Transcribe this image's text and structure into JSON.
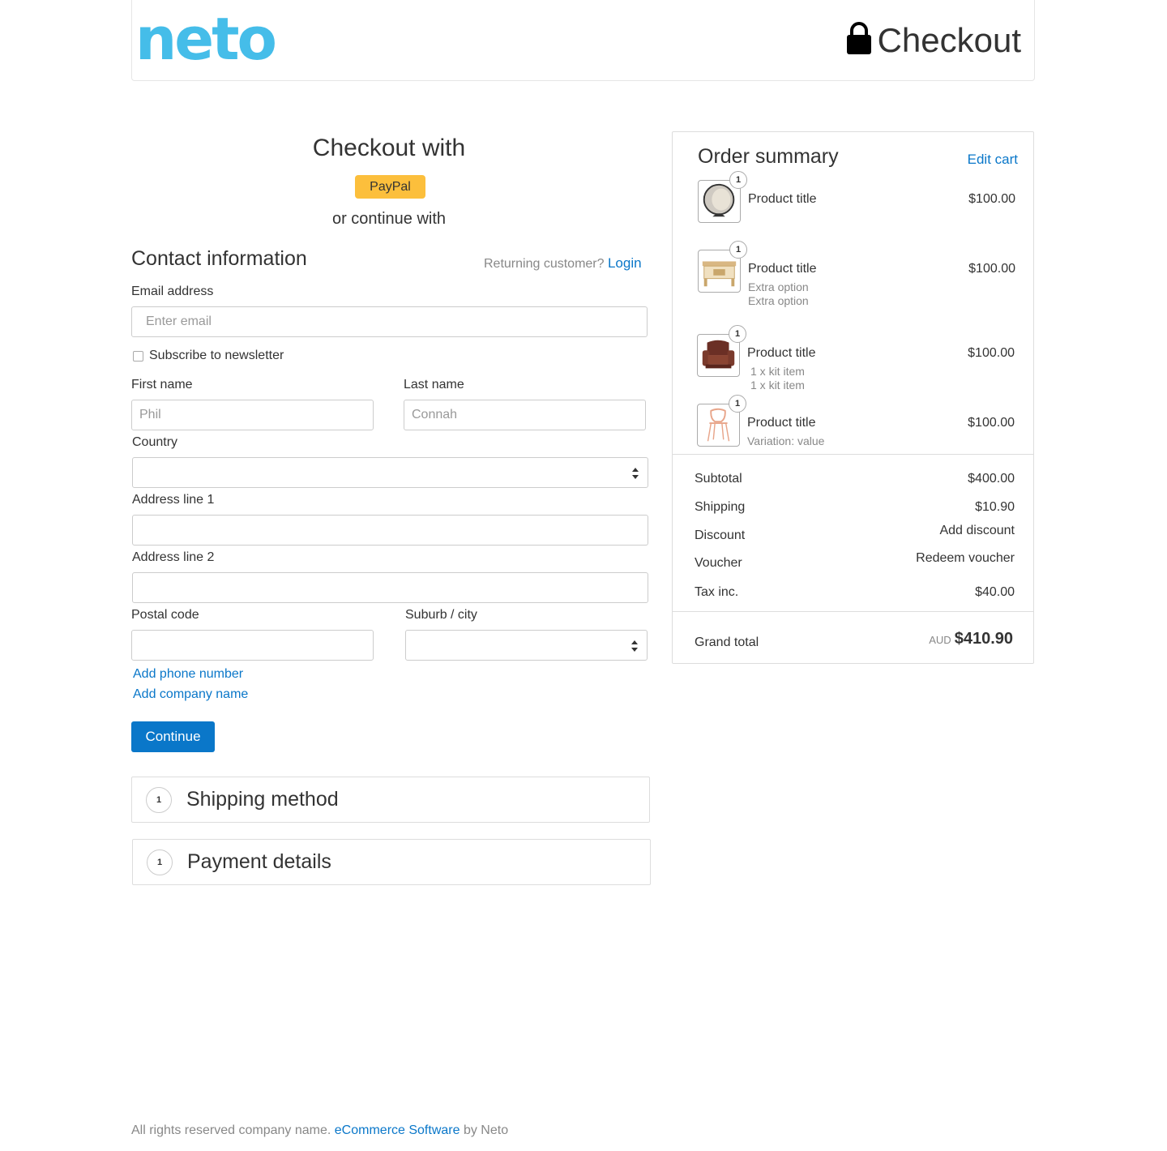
{
  "header": {
    "logo_text": "neto",
    "logo_color": "#45bde9",
    "title": "Checkout",
    "lock_icon": "lock-icon"
  },
  "express": {
    "title": "Checkout with",
    "paypal_label": "PayPal",
    "paypal_color": "#fcbf3c",
    "or_text": "or continue with"
  },
  "contact": {
    "title": "Contact information",
    "returning_text": "Returning customer?",
    "login_label": "Login",
    "email_label": "Email address",
    "email_placeholder": "Enter email",
    "newsletter_label": "Subscribe to newsletter",
    "first_name_label": "First name",
    "first_name_placeholder": "Phil",
    "last_name_label": "Last name",
    "last_name_placeholder": "Connah",
    "country_label": "Country",
    "address1_label": "Address line 1",
    "address2_label": "Address line 2",
    "postal_label": "Postal code",
    "suburb_label": "Suburb / city",
    "add_phone": "Add phone number",
    "add_company": "Add company name",
    "continue_label": "Continue"
  },
  "steps": [
    {
      "number": "1",
      "title": "Shipping method"
    },
    {
      "number": "1",
      "title": "Payment details"
    }
  ],
  "summary": {
    "title": "Order summary",
    "edit_cart": "Edit cart",
    "items": [
      {
        "qty": "1",
        "title": "Product title",
        "price": "$100.00",
        "details": [],
        "icon": "ball-chair-icon"
      },
      {
        "qty": "1",
        "title": "Product title",
        "price": "$100.00",
        "details": [
          "Extra option",
          "Extra option"
        ],
        "icon": "table-icon"
      },
      {
        "qty": "1",
        "title": "Product title",
        "price": "$100.00",
        "details": [
          "1 x kit item",
          "1 x kit item"
        ],
        "icon": "armchair-icon"
      },
      {
        "qty": "1",
        "title": "Product title",
        "price": "$100.00",
        "details": [
          "Variation: value"
        ],
        "icon": "chair-icon"
      }
    ],
    "subtotal_label": "Subtotal",
    "subtotal_value": "$400.00",
    "shipping_label": "Shipping",
    "shipping_value": "$10.90",
    "discount_label": "Discount",
    "discount_action": "Add discount",
    "voucher_label": "Voucher",
    "voucher_action": "Redeem voucher",
    "tax_label": "Tax inc.",
    "tax_value": "$40.00",
    "grand_label": "Grand total",
    "grand_currency": "AUD",
    "grand_value": "$410.90"
  },
  "footer": {
    "text": "All rights reserved company name.",
    "link": "eCommerce Software",
    "suffix": "by Neto"
  },
  "accent_color": "#0a77c9"
}
